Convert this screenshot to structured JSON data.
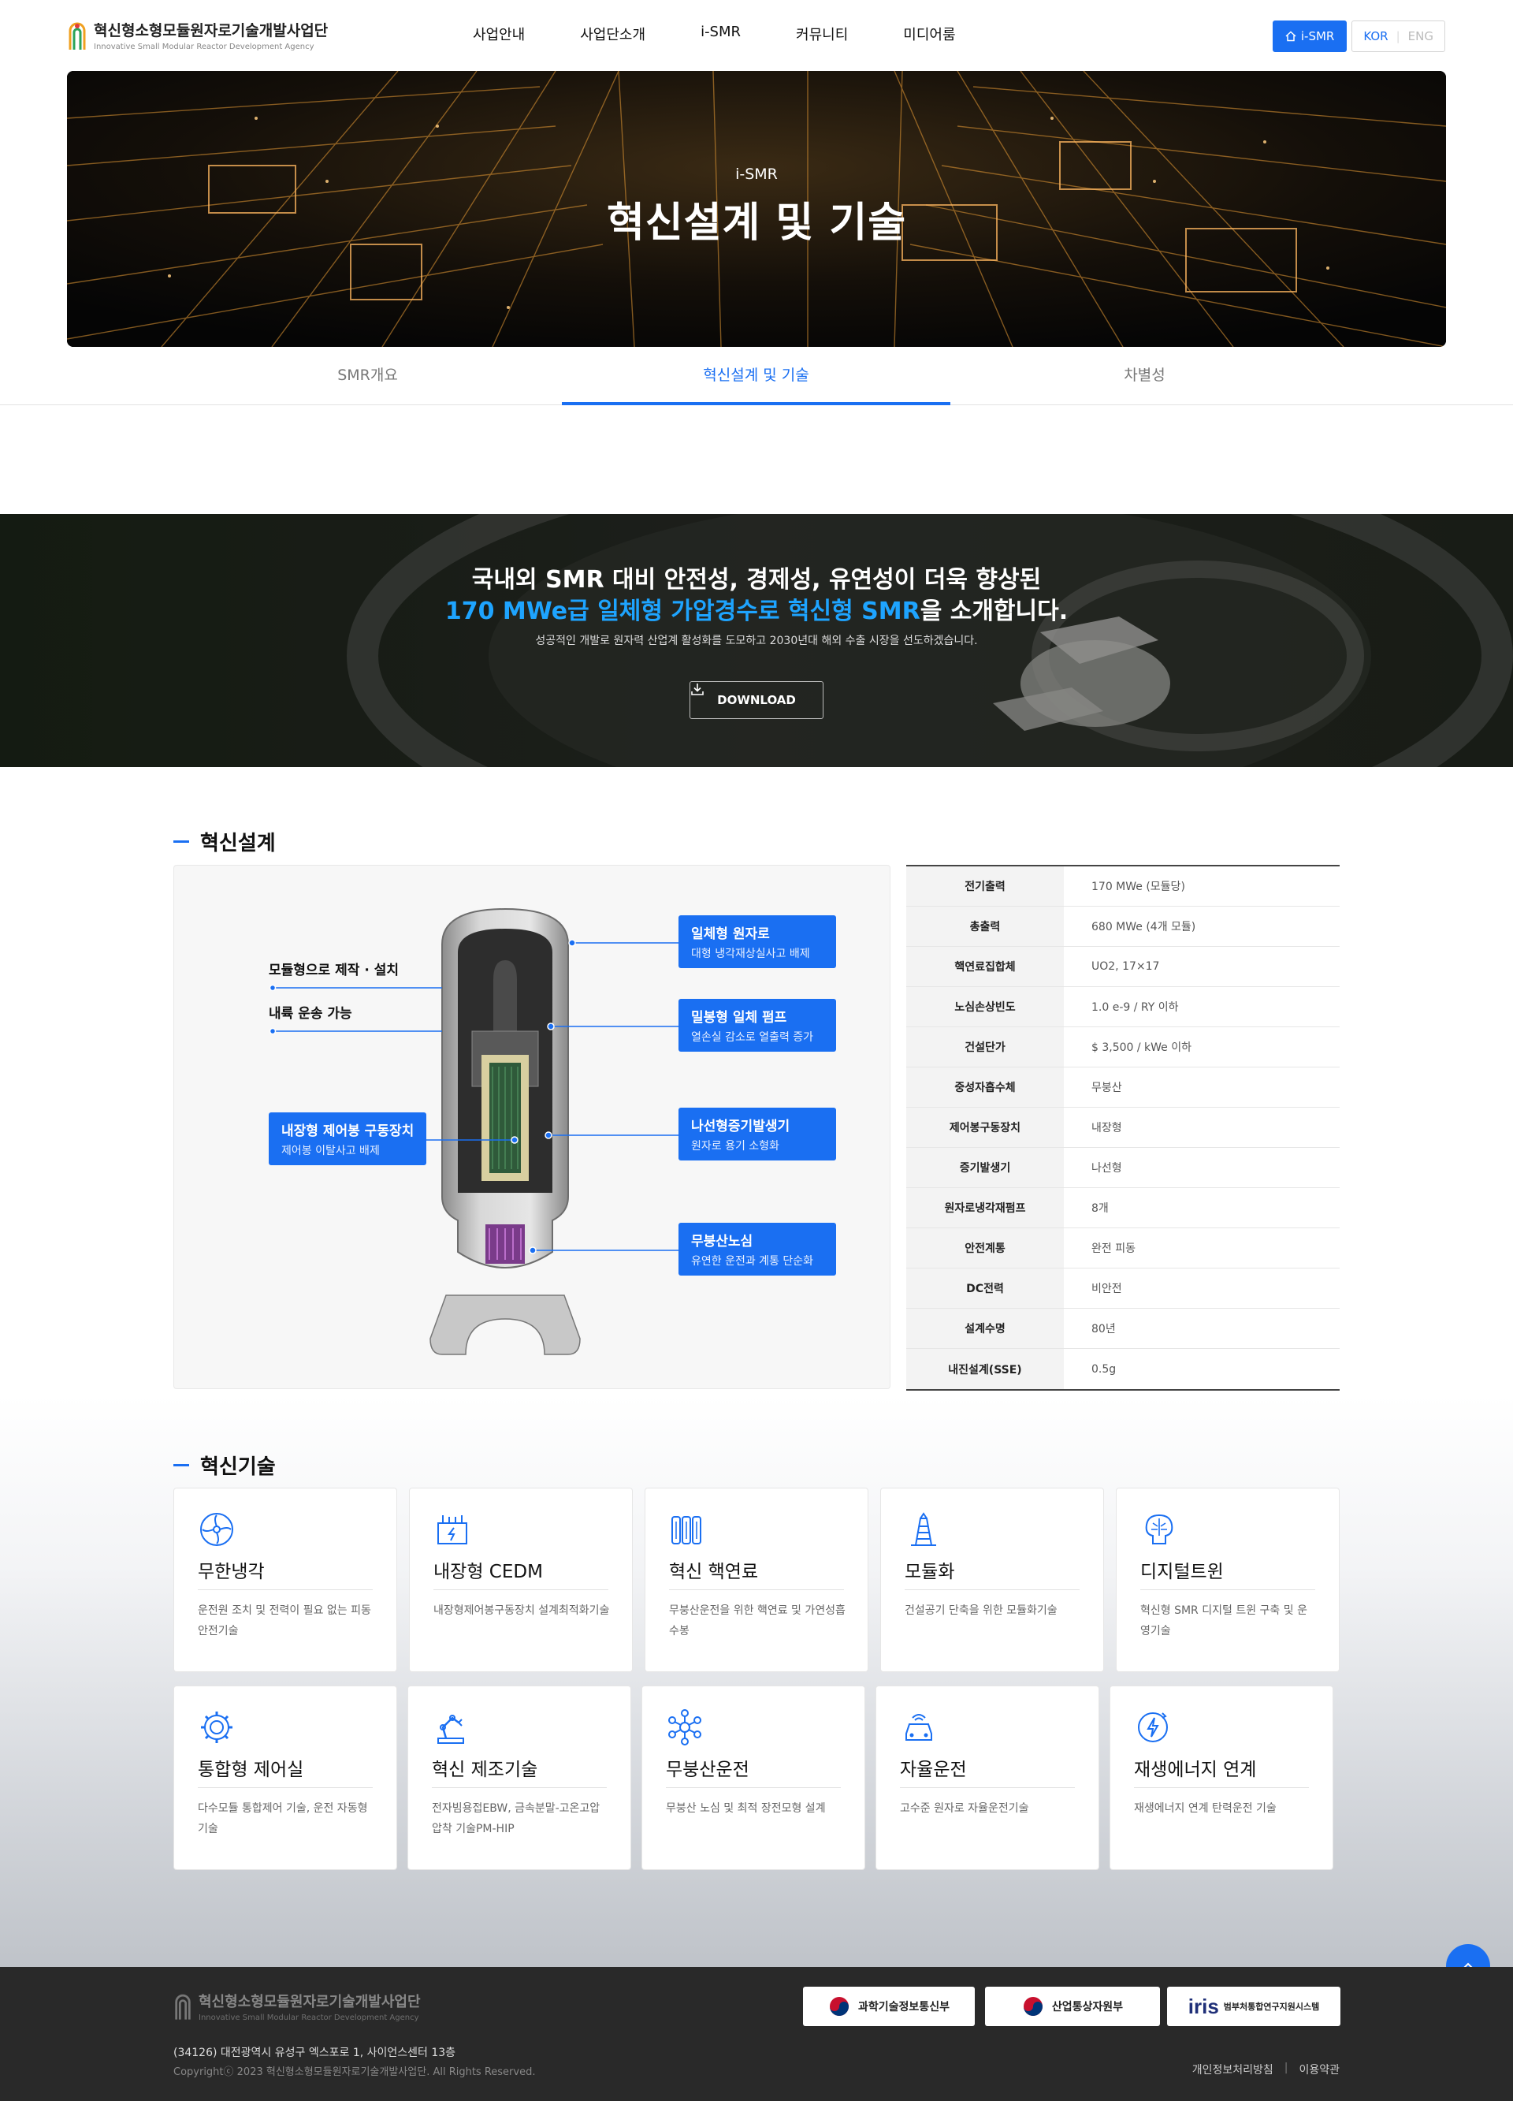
{
  "header": {
    "logo_title": "혁신형소형모듈원자로기술개발사업단",
    "logo_subtitle": "Innovative Small Modular Reactor Development Agency",
    "nav": [
      "사업안내",
      "사업단소개",
      "i-SMR",
      "커뮤니티",
      "미디어룸"
    ],
    "ismr_button": "i-SMR",
    "lang_kor": "KOR",
    "lang_eng": "ENG"
  },
  "hero": {
    "subtitle": "i-SMR",
    "title": "혁신설계 및 기술"
  },
  "tabs": [
    {
      "label": "SMR개요",
      "active": false
    },
    {
      "label": "혁신설계 및 기술",
      "active": true
    },
    {
      "label": "차별성",
      "active": false
    }
  ],
  "banner": {
    "line1": "국내외 SMR 대비 안전성, 경제성, 유연성이 더욱 향상된",
    "line2_highlight": "170 MWe급 일체형 가압경수로 혁신형 SMR",
    "line2_rest": "을 소개합니다.",
    "line3": "성공적인 개발로 원자력 산업계 활성화를 도모하고 2030년대 해외 수출 시장을 선도하겠습니다.",
    "download_label": "DOWNLOAD"
  },
  "design": {
    "section_title": "혁신설계",
    "left_labels": [
      "모듈형으로 제작 · 설치",
      "내륙 운송 가능"
    ],
    "callouts": [
      {
        "title": "일체형 원자로",
        "sub": "대형 냉각재상실사고 배제"
      },
      {
        "title": "밀봉형 일체 펌프",
        "sub": "열손실 감소로 열출력 증가"
      },
      {
        "title": "나선형증기발생기",
        "sub": "원자로 용기 소형화"
      },
      {
        "title": "무붕산노심",
        "sub": "유연한 운전과 계통 단순화"
      },
      {
        "title": "내장형 제어봉 구동장치",
        "sub": "제어봉 이탈사고 배제"
      }
    ],
    "specs": [
      {
        "k": "전기출력",
        "v": "170 MWe (모듈당)"
      },
      {
        "k": "총출력",
        "v": "680 MWe (4개 모듈)"
      },
      {
        "k": "핵연료집합체",
        "v": "UO2, 17×17"
      },
      {
        "k": "노심손상빈도",
        "v": "1.0 e-9 / RY 이하"
      },
      {
        "k": "건설단가",
        "v": "$ 3,500 / kWe 이하"
      },
      {
        "k": "중성자흡수체",
        "v": "무붕산"
      },
      {
        "k": "제어봉구동장치",
        "v": "내장형"
      },
      {
        "k": "증기발생기",
        "v": "나선형"
      },
      {
        "k": "원자로냉각재펌프",
        "v": "8개"
      },
      {
        "k": "안전계통",
        "v": "완전 피동"
      },
      {
        "k": "DC전력",
        "v": "비안전"
      },
      {
        "k": "설계수명",
        "v": "80년"
      },
      {
        "k": "내진설계(SSE)",
        "v": "0.5g"
      }
    ]
  },
  "tech": {
    "section_title": "혁신기술",
    "cards": [
      {
        "icon": "fan-cooling-icon",
        "title": "무한냉각",
        "desc": "운전원 조치 및 전력이 필요 없는 피동안전기술"
      },
      {
        "icon": "cedm-icon",
        "title": "내장형 CEDM",
        "desc": "내장형제어봉구동장치 설계최적화기술"
      },
      {
        "icon": "fuel-rods-icon",
        "title": "혁신 핵연료",
        "desc": "무붕산운전을 위한 핵연료 및 가연성흡수봉"
      },
      {
        "icon": "modular-tower-icon",
        "title": "모듈화",
        "desc": "건설공기 단축을 위한 모듈화기술"
      },
      {
        "icon": "brain-chip-icon",
        "title": "디지털트윈",
        "desc": "혁신형 SMR 디지털 트윈 구축 및 운영기술"
      },
      {
        "icon": "gear-icon",
        "title": "통합형 제어실",
        "desc": "다수모듈 통합제어 기술, 운전 자동형 기술"
      },
      {
        "icon": "robot-arm-icon",
        "title": "혁신 제조기술",
        "desc": "전자빔용접EBW, 금속분말-고온고압압착 기술PM-HIP"
      },
      {
        "icon": "molecule-icon",
        "title": "무붕산운전",
        "desc": "무붕산 노심 및 최적 장전모형 설계"
      },
      {
        "icon": "autonomous-car-icon",
        "title": "자율운전",
        "desc": "고수준 원자로 자율운전기술"
      },
      {
        "icon": "renewable-energy-icon",
        "title": "재생에너지 연계",
        "desc": "재생에너지 연계 탄력운전 기술"
      }
    ]
  },
  "footer": {
    "logo_title": "혁신형소형모듈원자로기술개발사업단",
    "logo_subtitle": "Innovative Small Modular Reactor Development Agency",
    "address": "(34126) 대전광역시 유성구 엑스포로 1, 사이언스센터 13층",
    "copyright": "Copyrightⓒ 2023 혁신형소형모듈원자로기술개발사업단. All Rights Reserved.",
    "badges": [
      "과학기술정보통신부",
      "산업통상자원부",
      "범부처통합연구지원시스템"
    ],
    "badge_iris": "iris",
    "links": [
      "개인정보처리방침",
      "이용약관"
    ]
  },
  "colors": {
    "accent": "#1a6ff2",
    "highlight": "#1ea4ff",
    "footer_bg": "#292929"
  }
}
